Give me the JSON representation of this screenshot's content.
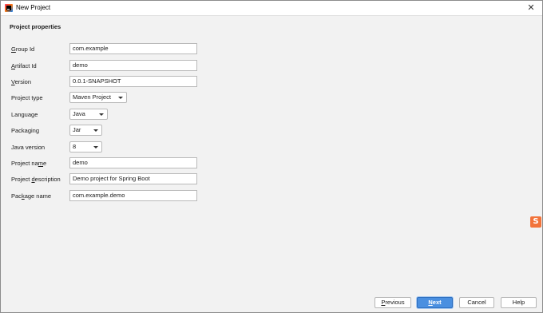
{
  "window": {
    "title": "New Project",
    "close_glyph": "✕"
  },
  "section_title": "Project properties",
  "fields": {
    "group_id": {
      "label_pre": "",
      "label_u": "G",
      "label_post": "roup Id",
      "value": "com.example"
    },
    "artifact_id": {
      "label_pre": "",
      "label_u": "A",
      "label_post": "rtifact Id",
      "value": "demo"
    },
    "version": {
      "label_pre": "",
      "label_u": "V",
      "label_post": "ersion",
      "value": "0.0.1-SNAPSHOT"
    },
    "project_type": {
      "label": "Project type",
      "value": "Maven Project"
    },
    "language": {
      "label": "Language",
      "value": "Java"
    },
    "packaging": {
      "label": "Packaging",
      "value": "Jar"
    },
    "java_version": {
      "label": "Java version",
      "value": "8"
    },
    "project_name": {
      "label_pre": "Project na",
      "label_u": "m",
      "label_post": "e",
      "value": "demo"
    },
    "project_description": {
      "label_pre": "Project ",
      "label_u": "d",
      "label_post": "escription",
      "value": "Demo project for Spring Boot"
    },
    "package_name": {
      "label_pre": "Pac",
      "label_u": "k",
      "label_post": "age name",
      "value": "com.example.demo"
    }
  },
  "buttons": {
    "previous": {
      "pre": "",
      "u": "P",
      "post": "revious"
    },
    "next": {
      "pre": "",
      "u": "N",
      "post": "ext"
    },
    "cancel": "Cancel",
    "help": "Help"
  },
  "tray_icon": {
    "glyph": "S",
    "icon": "sogou-ime-icon",
    "color": "#f2733a"
  },
  "colors": {
    "primary_button": "#4a8fe0",
    "window_bg": "#f2f2f2"
  }
}
